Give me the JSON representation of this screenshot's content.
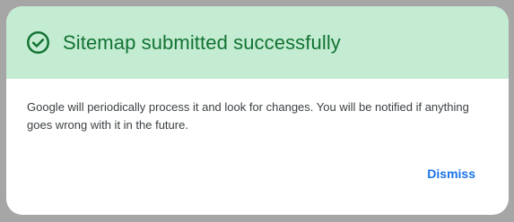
{
  "dialog": {
    "icon": "check-circle-icon",
    "title": "Sitemap submitted successfully",
    "message": "Google will periodically process it and look for changes. You will be notified if anything goes wrong with it in the future.",
    "dismiss_label": "Dismiss"
  },
  "colors": {
    "header_background": "#c3ecd2",
    "title": "#137333",
    "dismiss": "#1a73e8"
  }
}
